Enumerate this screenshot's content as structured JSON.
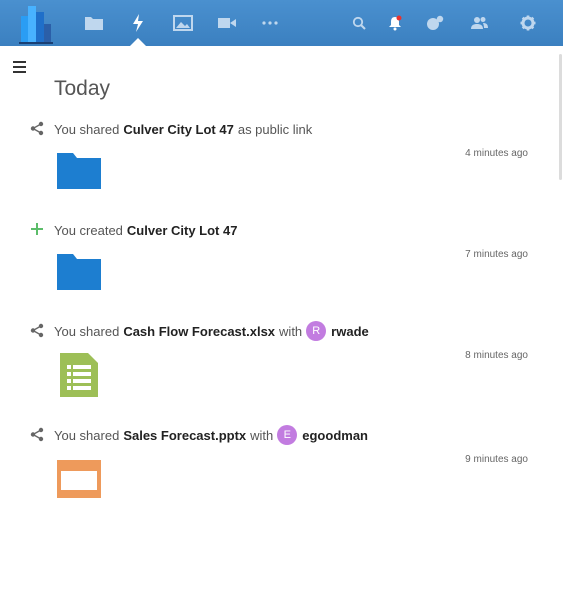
{
  "header": {
    "nav": [
      {
        "name": "files-icon"
      },
      {
        "name": "activity-icon",
        "active": true
      },
      {
        "name": "gallery-icon"
      },
      {
        "name": "video-icon"
      },
      {
        "name": "more-icon"
      }
    ],
    "right": [
      "search-icon",
      "notifications-icon",
      "contacts-circle-icon",
      "contacts-icon",
      "settings-icon"
    ],
    "colors": {
      "bar": "#3b80c0",
      "icon": "#bfd7ee",
      "active_icon": "#ffffff",
      "notification_dot": "#e9322d"
    }
  },
  "page_title": "Today",
  "activities": [
    {
      "icon": "share-icon",
      "prefix": "You shared",
      "subject": "Culver City Lot 47",
      "suffix": "as public link",
      "time": "4 minutes ago",
      "thumb": "folder-icon"
    },
    {
      "icon": "plus-icon",
      "prefix": "You created",
      "subject": "Culver City Lot 47",
      "suffix": "",
      "time": "7 minutes ago",
      "thumb": "folder-icon"
    },
    {
      "icon": "share-icon",
      "prefix": "You shared",
      "subject": "Cash Flow Forecast.xlsx",
      "suffix": "with",
      "user_initial": "R",
      "user": "rwade",
      "time": "8 minutes ago",
      "thumb": "spreadsheet-icon"
    },
    {
      "icon": "share-icon",
      "prefix": "You shared",
      "subject": "Sales Forecast.pptx",
      "suffix": "with",
      "user_initial": "E",
      "user": "egoodman",
      "time": "9 minutes ago",
      "thumb": "presentation-icon"
    }
  ],
  "colors": {
    "folder": "#1d7ed0",
    "spreadsheet": "#9dbf57",
    "presentation": "#ee9a5b",
    "avatar": "#c27ce0",
    "plus": "#5cbd6a"
  }
}
